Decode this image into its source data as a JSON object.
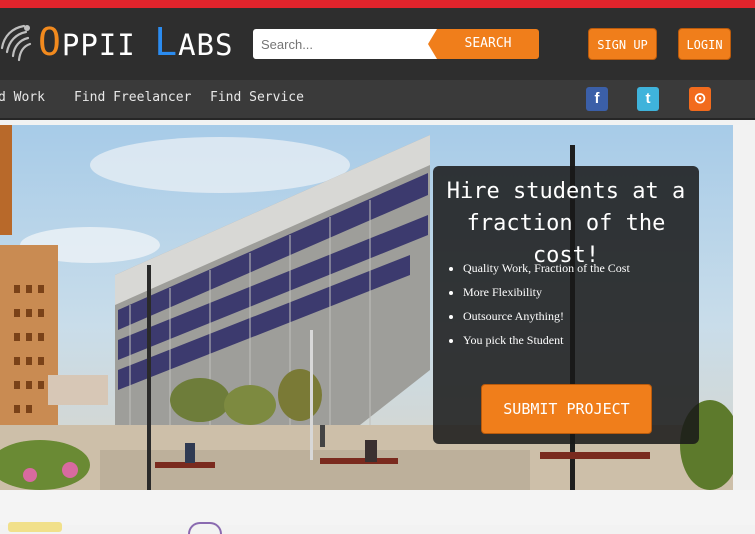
{
  "brand": {
    "name_o": "O",
    "name_rest1": "PPII ",
    "name_l": "L",
    "name_rest2": "ABS",
    "accent": "#f07e1b",
    "blue": "#2b8cf0",
    "topbar": "#e2242c"
  },
  "search": {
    "placeholder": "Search...",
    "button_label": "SEARCH"
  },
  "header_buttons": {
    "signup": "SIGN UP",
    "login": "LOGIN"
  },
  "nav": {
    "items": [
      "d Work",
      "Find Freelancer",
      "Find Service"
    ]
  },
  "social": [
    {
      "icon": "facebook-icon",
      "glyph": "f",
      "color": "#3b5fa8"
    },
    {
      "icon": "twitter-icon",
      "glyph": "t",
      "color": "#3fb3db"
    },
    {
      "icon": "rss-icon",
      "glyph": "⊙",
      "color": "#f26b1d"
    }
  ],
  "hero": {
    "title_line1": "Hire students at a",
    "title_line2": "fraction of the cost!",
    "bullets": [
      "Quality Work, Fraction of the Cost",
      "More Flexibility",
      "Outsource Anything!",
      "You pick the Student"
    ],
    "submit_label": "SUBMIT PROJECT"
  }
}
